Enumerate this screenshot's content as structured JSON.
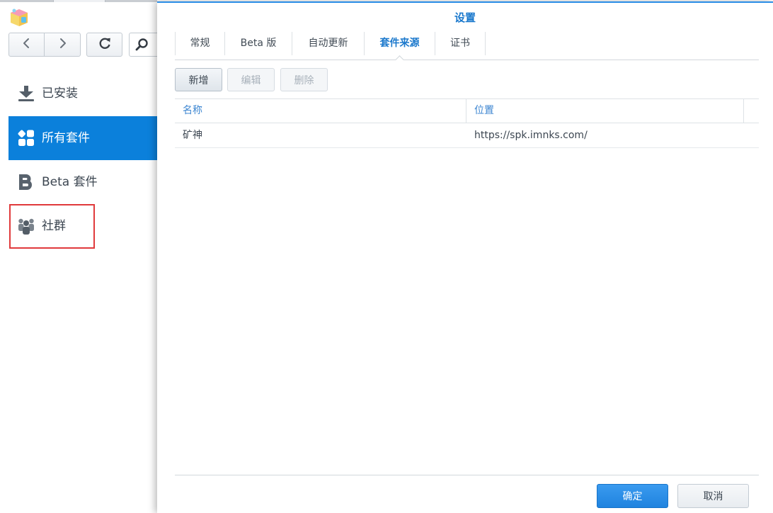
{
  "app": {
    "app_icon": "package-center-icon",
    "nav": {
      "back_icon": "chevron-left-icon",
      "forward_icon": "chevron-right-icon",
      "refresh_icon": "refresh-icon",
      "search_icon": "search-icon"
    },
    "sidebar": {
      "items": [
        {
          "label": "已安装",
          "icon": "download-icon",
          "selected": false
        },
        {
          "label": "所有套件",
          "icon": "grid-icon",
          "selected": true
        },
        {
          "label": "Beta 套件",
          "icon": "beta-icon",
          "selected": false
        },
        {
          "label": "社群",
          "icon": "community-icon",
          "selected": false,
          "highlighted": true
        }
      ]
    }
  },
  "dialog": {
    "title": "设置",
    "tabs": [
      {
        "label": "常规",
        "active": false
      },
      {
        "label": "Beta 版",
        "active": false
      },
      {
        "label": "自动更新",
        "active": false
      },
      {
        "label": "套件来源",
        "active": true
      },
      {
        "label": "证书",
        "active": false
      }
    ],
    "toolbar": {
      "add_label": "新增",
      "add_enabled": true,
      "edit_label": "编辑",
      "edit_enabled": false,
      "delete_label": "删除",
      "delete_enabled": false
    },
    "table": {
      "columns": [
        {
          "label": "名称"
        },
        {
          "label": "位置"
        }
      ],
      "rows": [
        {
          "name": "矿神",
          "location": "https://spk.imnks.com/"
        }
      ]
    },
    "footer": {
      "ok_label": "确定",
      "cancel_label": "取消"
    }
  },
  "colors": {
    "accent": "#0b80db",
    "title": "#1877cc",
    "primary_button": "#2a8de6",
    "annotation": "#e03a3c",
    "text": "#3c4651"
  }
}
